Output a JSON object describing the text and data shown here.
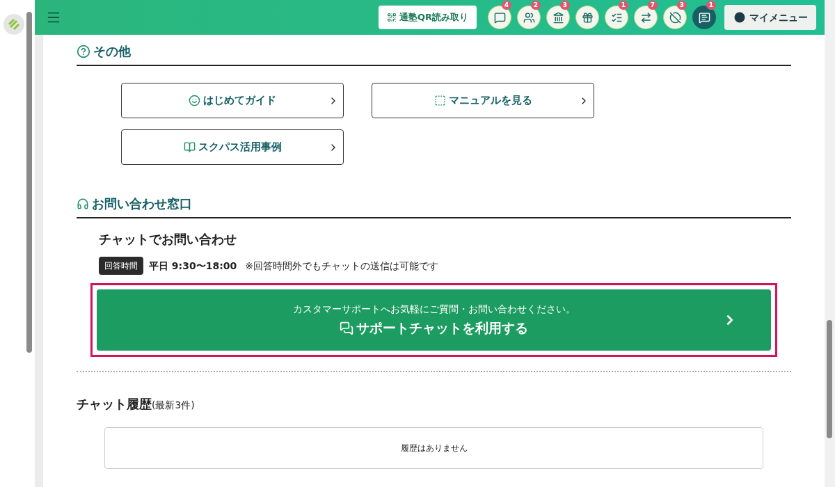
{
  "header": {
    "qr_button": "通塾QR読み取り",
    "icons": [
      {
        "kind": "message",
        "badge": "4",
        "selected": false
      },
      {
        "kind": "users",
        "badge": "2",
        "selected": false
      },
      {
        "kind": "bank",
        "badge": "3",
        "selected": false
      },
      {
        "kind": "gift",
        "selected": false
      },
      {
        "kind": "checklist",
        "badge": "1",
        "selected": false
      },
      {
        "kind": "arrows",
        "badge": "7",
        "selected": false
      },
      {
        "kind": "blocked",
        "badge": "3",
        "selected": false
      },
      {
        "kind": "chat",
        "badge": "1",
        "selected": true
      }
    ],
    "my_menu": "マイメニュー"
  },
  "other_section": {
    "title": "その他",
    "links": [
      {
        "kind": "smile",
        "label": "はじめてガイド"
      },
      {
        "kind": "manual",
        "label": "マニュアルを見る"
      },
      {
        "kind": "book",
        "label": "スクパス活用事例"
      }
    ]
  },
  "contact_section": {
    "title": "お問い合わせ窓口",
    "chat_title": "チャットでお問い合わせ",
    "hours_tag": "回答時間",
    "hours": "平日 9:30〜18:00",
    "hours_note": "※回答時間外でもチャットの送信は可能です",
    "chat_button": {
      "caption": "カスタマーサポートへお気軽にご質問・お問い合わせください。",
      "label": "サポートチャットを利用する"
    }
  },
  "history": {
    "title": "チャット履歴",
    "subtitle": "(最新3件)",
    "empty": "履歴はありません"
  }
}
